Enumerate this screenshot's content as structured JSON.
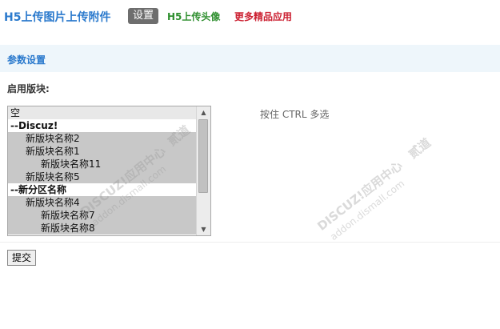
{
  "topnav": {
    "title": "H5上传图片上传附件",
    "tabs": [
      {
        "label": "设置",
        "active": true
      },
      {
        "label": "H5上传头像"
      },
      {
        "label": "更多精品应用"
      }
    ]
  },
  "section": {
    "title": "参数设置"
  },
  "form": {
    "enable_label": "启用版块:",
    "options": [
      {
        "label": "空",
        "indent": 0,
        "group": false,
        "selected": false
      },
      {
        "label": "--Discuz!",
        "indent": 0,
        "group": true,
        "selected": false
      },
      {
        "label": "新版块名称2",
        "indent": 1,
        "group": false,
        "selected": true
      },
      {
        "label": "新版块名称1",
        "indent": 1,
        "group": false,
        "selected": true
      },
      {
        "label": "新版块名称11",
        "indent": 2,
        "group": false,
        "selected": true
      },
      {
        "label": "新版块名称5",
        "indent": 1,
        "group": false,
        "selected": true
      },
      {
        "label": "--新分区名称",
        "indent": 0,
        "group": true,
        "selected": false
      },
      {
        "label": "新版块名称4",
        "indent": 1,
        "group": false,
        "selected": true
      },
      {
        "label": "新版块名称7",
        "indent": 2,
        "group": false,
        "selected": true
      },
      {
        "label": "新版块名称8",
        "indent": 2,
        "group": false,
        "selected": true
      }
    ],
    "hint": "按住 CTRL 多选",
    "submit_label": "提交"
  },
  "watermark": {
    "brand": "DISCUZ!应用中心",
    "brand2": "贰道",
    "site": "addon.dismall.com"
  },
  "icons": {
    "scroll_up": "triangle-up-icon",
    "scroll_down": "triangle-down-icon"
  }
}
